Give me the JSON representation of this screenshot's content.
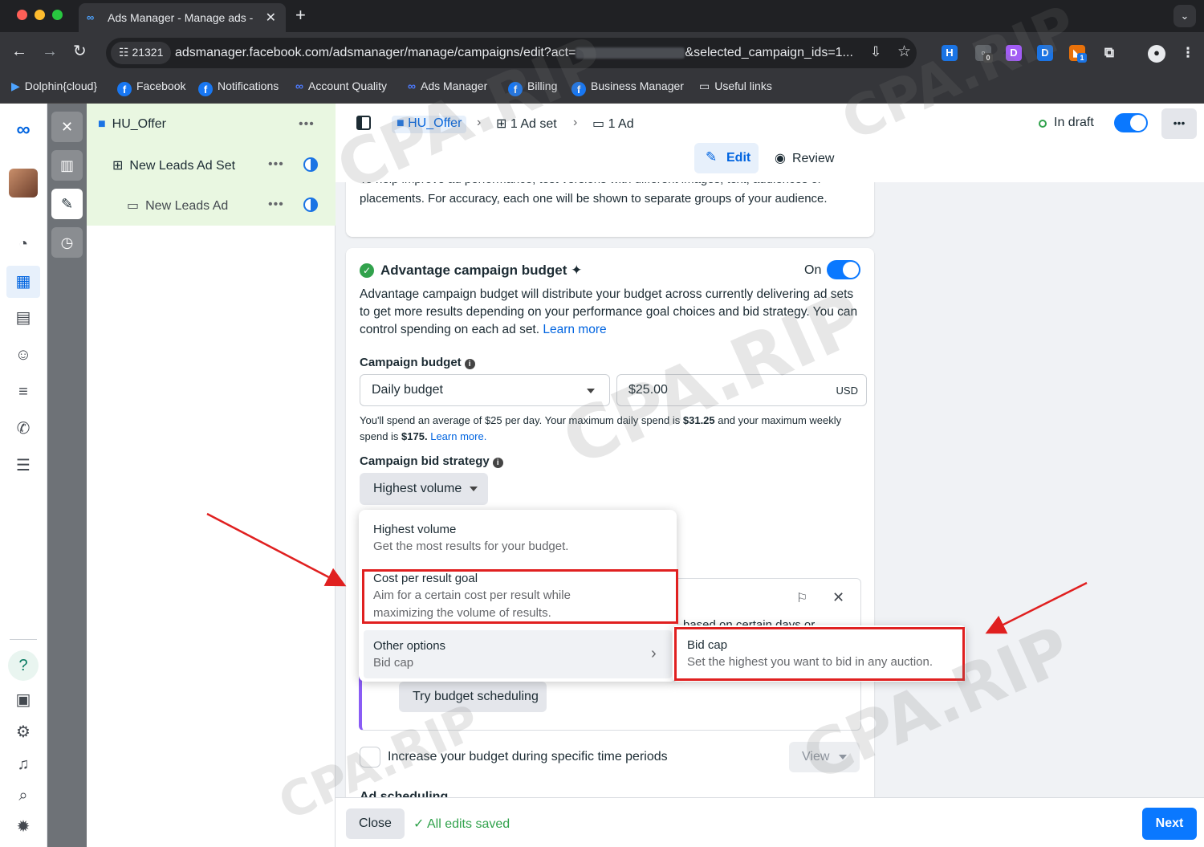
{
  "browser": {
    "tab_title": "Ads Manager - Manage ads -",
    "tab_close": "✕",
    "new_tab": "+",
    "site_id": "21321",
    "url_prefix": "adsmanager.facebook.com/adsmanager/manage/campaigns/edit?act=",
    "url_suffix": "&selected_campaign_ids=1...",
    "bookmarks": [
      "Dolphin{cloud}",
      "Facebook",
      "Notifications",
      "Account Quality",
      "Ads Manager",
      "Billing",
      "Business Manager",
      "Useful links"
    ],
    "ext_badges": [
      "0",
      "1"
    ]
  },
  "tree": {
    "campaign": "HU_Offer",
    "adset": "New Leads Ad Set",
    "ad": "New Leads Ad",
    "more": "•••"
  },
  "header": {
    "crumbs": [
      "HU_Offer",
      "1 Ad set",
      "1 Ad"
    ],
    "status": "In draft",
    "more": "•••",
    "tab_edit": "Edit",
    "tab_review": "Review"
  },
  "main": {
    "top_text_cut": "To help improve ad performance, test versions with different images, text, audiences or",
    "top_text": "placements. For accuracy, each one will be shown to separate groups of your audience.",
    "acb_title": "Advantage campaign budget ✦",
    "acb_toggle_label": "On",
    "acb_desc": "Advantage campaign budget will distribute your budget across currently delivering ad sets to get more results depending on your performance goal choices and bid strategy. You can control spending on each ad set.",
    "learn_more": "Learn more",
    "budget_label": "Campaign budget",
    "budget_type": "Daily budget",
    "budget_amount": "$25.00",
    "currency": "USD",
    "spend_note_1": "You'll spend an average of $25 per day. Your maximum daily spend is",
    "spend_max_daily": "$31.25",
    "spend_note_2": "and your maximum weekly spend is",
    "spend_max_weekly": "$175.",
    "learn_more_dot": "Learn more.",
    "bid_label": "Campaign bid strategy",
    "bid_selected": "Highest volume",
    "hidden_text": "based on certain days or",
    "try_scheduling": "Try budget scheduling",
    "increase_label": "Increase your budget during specific time periods",
    "view": "View",
    "ad_scheduling_cut": "Ad scheduling"
  },
  "menu": {
    "items": [
      {
        "title": "Highest volume",
        "desc": "Get the most results for your budget."
      },
      {
        "title": "Cost per result goal",
        "desc": "Aim for a certain cost per result while maximizing the volume of results."
      },
      {
        "title": "Other options",
        "desc": "Bid cap"
      }
    ],
    "submenu": {
      "title": "Bid cap",
      "desc": "Set the highest you want to bid in any auction."
    }
  },
  "footer": {
    "close": "Close",
    "saved": "All edits saved",
    "next": "Next"
  },
  "watermark": "CPA.RIP",
  "colors": {
    "accent": "#0a78ff",
    "highlight_box": "#e02020",
    "success": "#31a24c"
  }
}
